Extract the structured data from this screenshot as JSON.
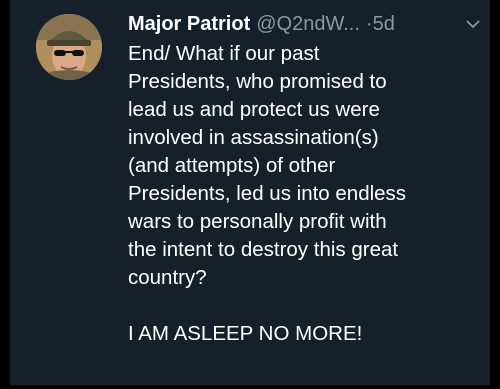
{
  "tweet": {
    "display_name": "Major Patriot",
    "handle": "@Q2ndW...",
    "separator": "·",
    "age": "5d",
    "body_lines": [
      "End/  What if our past",
      "Presidents, who promised to",
      "lead us and protect us were",
      "involved in assassination(s)",
      "(and attempts) of other",
      "Presidents, led us into endless",
      "wars to personally profit with",
      "the intent to destroy this great",
      "country?"
    ],
    "closing_line": "I AM ASLEEP NO MORE!",
    "avatar_icon": "profile-photo-military-cap",
    "menu_icon": "chevron-down-icon"
  },
  "colors": {
    "card_background": "#15202b",
    "outer_background": "#000000",
    "primary_text": "#ffffff",
    "secondary_text": "#8899a6"
  }
}
